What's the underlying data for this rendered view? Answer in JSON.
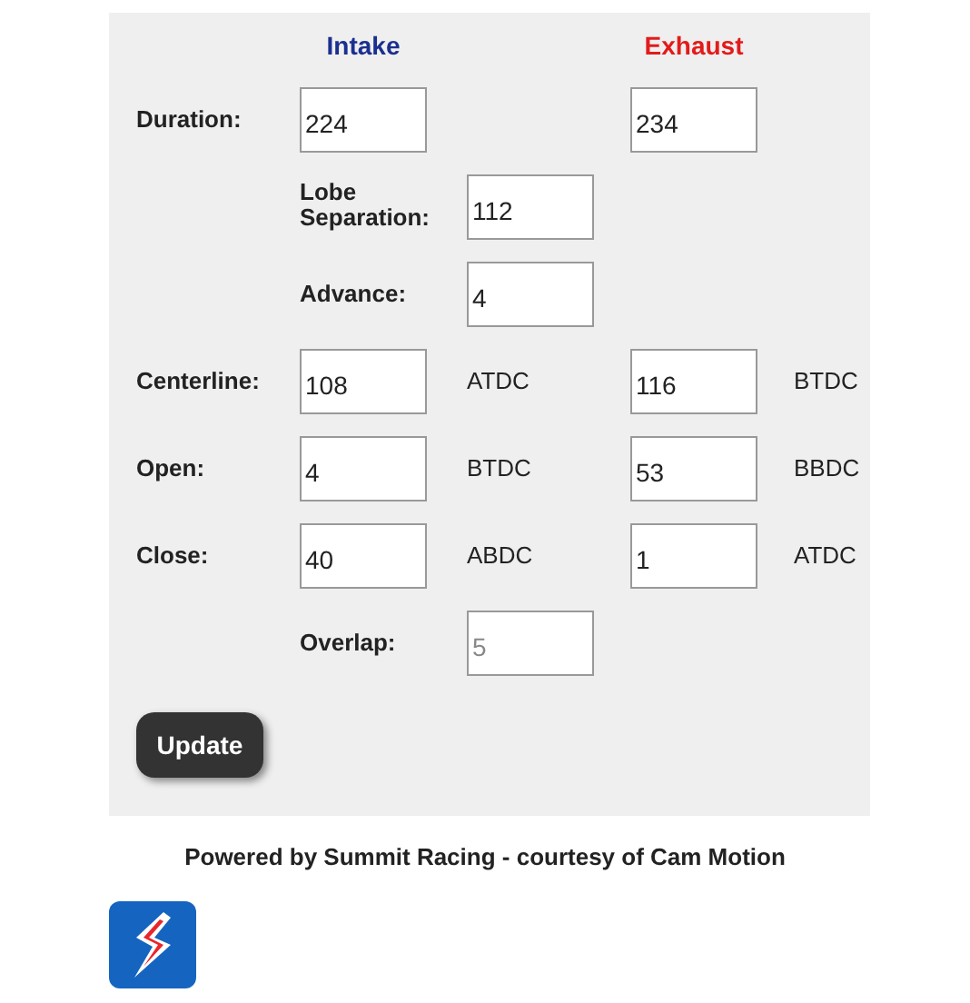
{
  "columns": [
    {
      "label": "Intake",
      "color": "#1a2f8f"
    },
    {
      "label": "Exhaust",
      "color": "#e21b1b"
    }
  ],
  "rows": [
    {
      "kind": "pair",
      "label": "Duration:",
      "intake": {
        "value": "224"
      },
      "exhaust": {
        "value": "234"
      }
    },
    {
      "kind": "single",
      "label": "Lobe Separation:",
      "value": "112",
      "disabled": false
    },
    {
      "kind": "single",
      "label": "Advance:",
      "value": "4",
      "disabled": false
    },
    {
      "kind": "pair",
      "label": "Centerline:",
      "intake": {
        "value": "108",
        "unit": "ATDC"
      },
      "exhaust": {
        "value": "116",
        "unit": "BTDC"
      }
    },
    {
      "kind": "pair",
      "label": "Open:",
      "intake": {
        "value": "4",
        "unit": "BTDC"
      },
      "exhaust": {
        "value": "53",
        "unit": "BBDC"
      }
    },
    {
      "kind": "pair",
      "label": "Close:",
      "intake": {
        "value": "40",
        "unit": "ABDC"
      },
      "exhaust": {
        "value": "1",
        "unit": "ATDC"
      }
    },
    {
      "kind": "single",
      "label": "Overlap:",
      "value": "5",
      "disabled": true
    }
  ],
  "button": "Update",
  "footer": "Powered by Summit Racing - courtesy of Cam Motion"
}
